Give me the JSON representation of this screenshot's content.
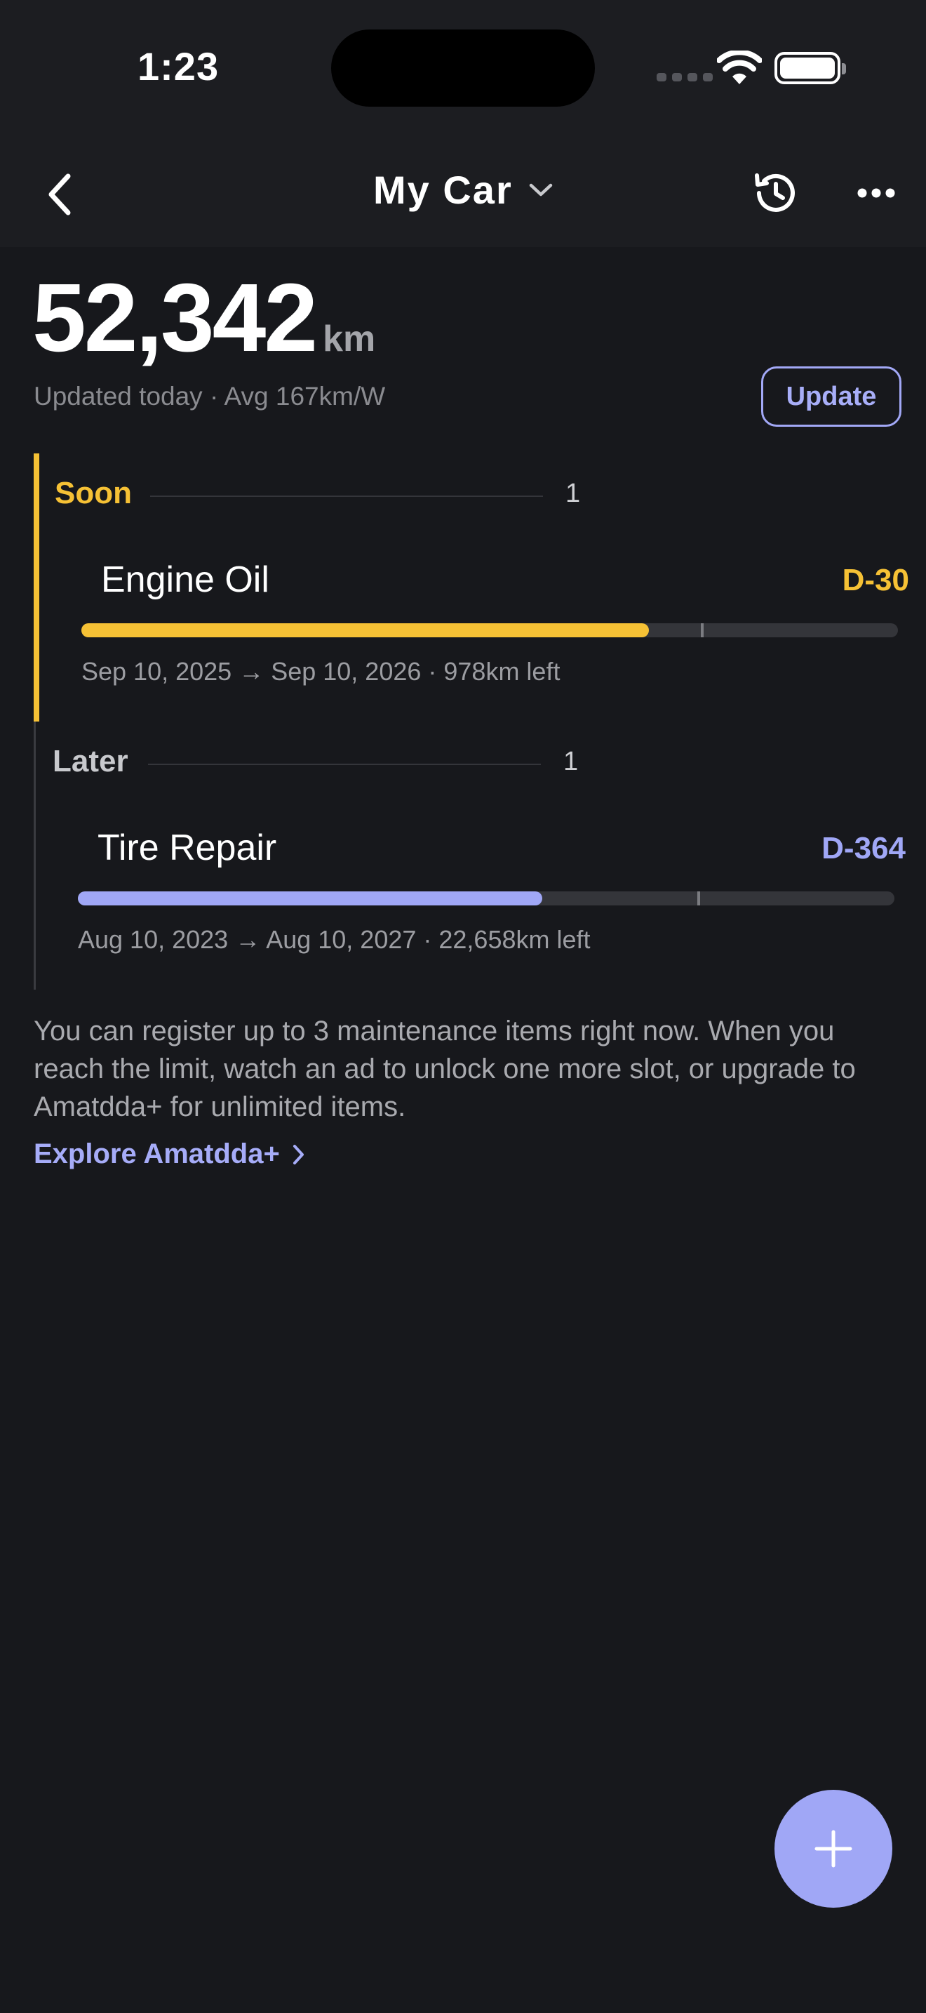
{
  "status_bar": {
    "time": "1:23"
  },
  "nav": {
    "title": "My Car"
  },
  "odometer": {
    "value": "52,342",
    "unit": "km",
    "meta": "Updated today · Avg 167km/W",
    "update_label": "Update"
  },
  "groups": [
    {
      "label": "Soon",
      "count": "1",
      "color": "#f6c135",
      "items": [
        {
          "name": "Engine Oil",
          "dday": "D-30",
          "progress": 0.695,
          "marker": 0.759,
          "meta": "Sep 10, 2025 → Sep 10, 2026 · 978km left"
        }
      ]
    },
    {
      "label": "Later",
      "count": "1",
      "color": "#a0a7f6",
      "items": [
        {
          "name": "Tire Repair",
          "dday": "D-364",
          "progress": 0.569,
          "marker": 0.759,
          "meta": "Aug 10, 2023 → Aug 10, 2027 · 22,658km left"
        }
      ]
    }
  ],
  "info": {
    "text": "You can register up to 3 maintenance items right now. When you reach the limit, watch an ad to unlock one more slot, or upgrade to Amatdda+ for unlimited items.",
    "link_label": "Explore Amatdda+"
  },
  "icons": {
    "back": "chevron-left-icon",
    "title_dropdown": "chevron-down-icon",
    "history": "history-icon",
    "more": "more-horizontal-icon",
    "link_chevron": "chevron-right-icon",
    "add": "plus-icon"
  }
}
